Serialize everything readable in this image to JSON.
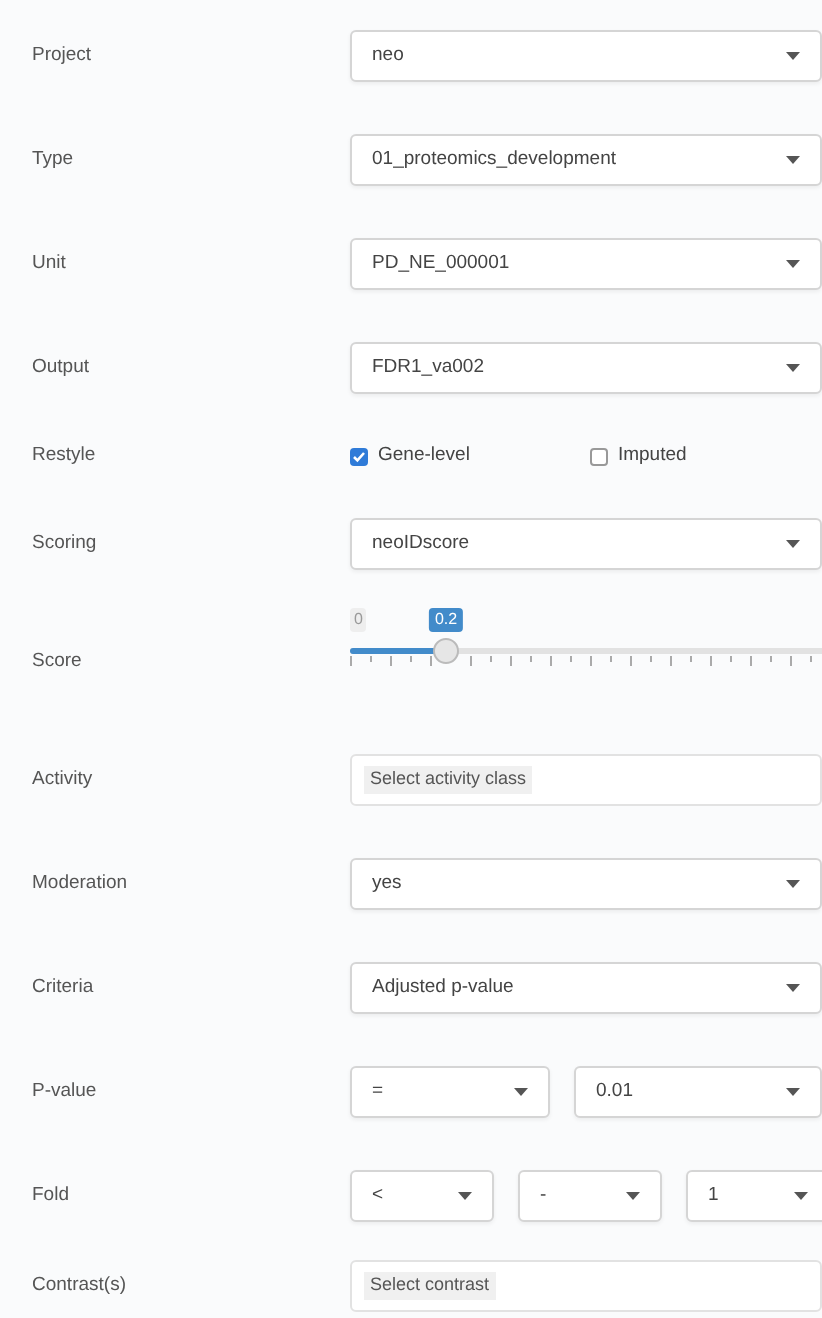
{
  "fields": [
    {
      "kind": "select",
      "label": "Project",
      "value": "neo"
    },
    {
      "kind": "select",
      "label": "Type",
      "value": "01_proteomics_development"
    },
    {
      "kind": "select",
      "label": "Unit",
      "value": "PD_NE_000001"
    },
    {
      "kind": "select",
      "label": "Output",
      "value": "FDR1_va002"
    },
    {
      "kind": "checks",
      "label": "Restyle",
      "options": [
        {
          "label": "Gene-level",
          "checked": true
        },
        {
          "label": "Imputed",
          "checked": false
        }
      ]
    },
    {
      "kind": "select",
      "label": "Scoring",
      "value": "neoIDscore"
    },
    {
      "kind": "slider",
      "label": "Score",
      "min_label": "0",
      "value": "0.2",
      "level": 0.2
    },
    {
      "kind": "multi",
      "label": "Activity",
      "placeholder": "Select activity class"
    },
    {
      "kind": "select",
      "label": "Moderation",
      "value": "yes"
    },
    {
      "kind": "select",
      "label": "Criteria",
      "value": "Adjusted p-value"
    },
    {
      "kind": "selects",
      "label": "P-value",
      "values": [
        "=",
        "0.01"
      ]
    },
    {
      "kind": "selects",
      "label": "Fold",
      "values": [
        "<",
        "-",
        "1"
      ]
    },
    {
      "kind": "multi",
      "label": "Contrast(s)",
      "placeholder": "Select contrast"
    }
  ]
}
